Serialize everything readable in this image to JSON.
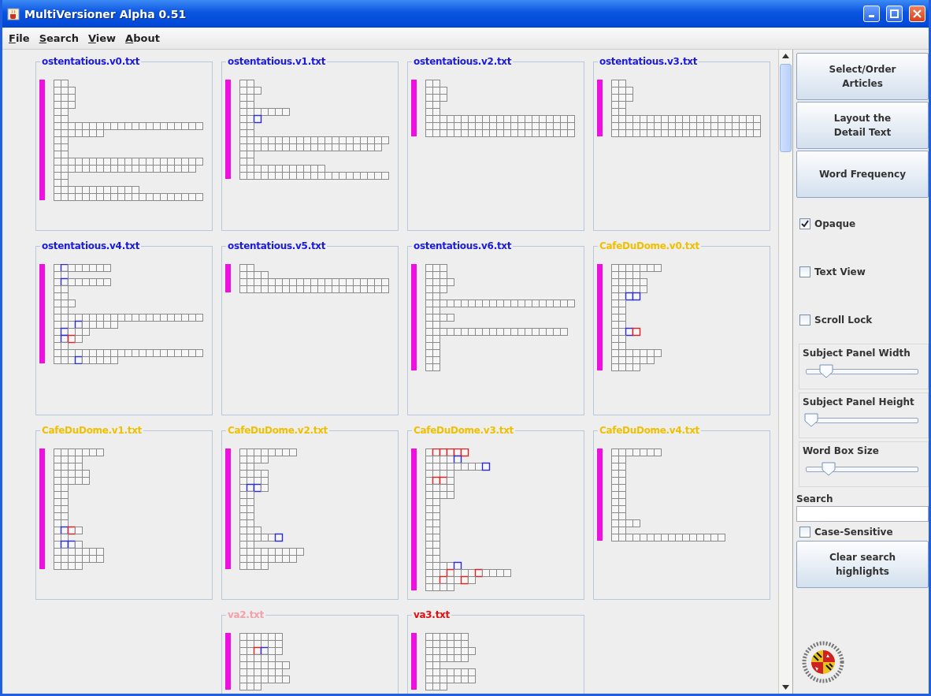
{
  "window": {
    "title": "MultiVersioner Alpha 0.51"
  },
  "menu": [
    {
      "label": "File"
    },
    {
      "label": "Search"
    },
    {
      "label": "View"
    },
    {
      "label": "About"
    }
  ],
  "panel_rows": [
    [
      {
        "title": "ostentatious.v0.txt",
        "color": "#1a1adc"
      },
      {
        "title": "ostentatious.v1.txt",
        "color": "#1a1adc"
      },
      {
        "title": "ostentatious.v2.txt",
        "color": "#1a1adc"
      },
      {
        "title": "ostentatious.v3.txt",
        "color": "#1a1adc"
      }
    ],
    [
      {
        "title": "ostentatious.v4.txt",
        "color": "#1a1adc"
      },
      {
        "title": "ostentatious.v5.txt",
        "color": "#1a1adc"
      },
      {
        "title": "ostentatious.v6.txt",
        "color": "#1a1adc"
      },
      {
        "title": "CafeDuDome.v0.txt",
        "color": "#f0c000"
      }
    ],
    [
      {
        "title": "CafeDuDome.v1.txt",
        "color": "#f0c000"
      },
      {
        "title": "CafeDuDome.v2.txt",
        "color": "#f0c000"
      },
      {
        "title": "CafeDuDome.v3.txt",
        "color": "#f0c000"
      },
      {
        "title": "CafeDuDome.v4.txt",
        "color": "#f0c000"
      }
    ],
    [
      {
        "title": "va2.txt",
        "color": "#f4a0a8"
      },
      {
        "title": "va3.txt",
        "color": "#e01010"
      }
    ]
  ],
  "sidebar": {
    "buttons": [
      {
        "label": "Select/Order\nArticles"
      },
      {
        "label": "Layout the\nDetail Text"
      },
      {
        "label": "Word Frequency"
      }
    ],
    "checkboxes": [
      {
        "label": "Opaque",
        "checked": true
      },
      {
        "label": "Text View",
        "checked": false
      },
      {
        "label": "Scroll Lock",
        "checked": false
      }
    ],
    "sliders": [
      {
        "label": "Subject Panel Width",
        "level": 0.18
      },
      {
        "label": "Subject Panel Height",
        "level": 0.05
      },
      {
        "label": "Word Box Size",
        "level": 0.2
      }
    ],
    "search": {
      "label": "Search"
    },
    "case_sensitive": {
      "label": "Case-Sensitive",
      "checked": false
    },
    "clear_button": {
      "label": "Clear search\nhighlights"
    }
  }
}
